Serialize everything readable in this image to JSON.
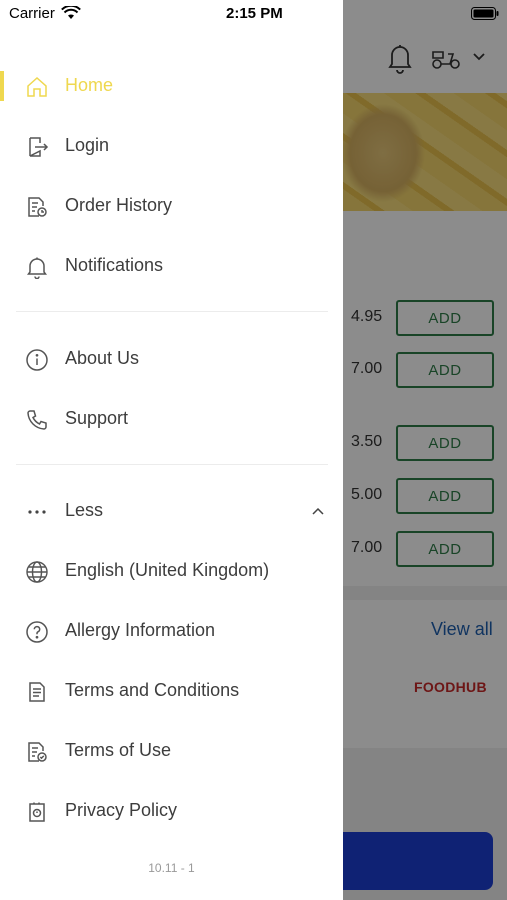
{
  "status_bar": {
    "carrier": "Carrier",
    "time": "2:15 PM"
  },
  "drawer": {
    "items_group1": [
      {
        "label": "Home",
        "icon": "home-icon",
        "active": true
      },
      {
        "label": "Login",
        "icon": "login-icon",
        "active": false
      },
      {
        "label": "Order History",
        "icon": "order-history-icon",
        "active": false
      },
      {
        "label": "Notifications",
        "icon": "bell-icon",
        "active": false
      }
    ],
    "items_group2": [
      {
        "label": "About Us",
        "icon": "info-icon"
      },
      {
        "label": "Support",
        "icon": "phone-icon"
      }
    ],
    "less_label": "Less",
    "items_group3": [
      {
        "label": "English (United Kingdom)",
        "icon": "globe-icon"
      },
      {
        "label": "Allergy Information",
        "icon": "question-icon"
      },
      {
        "label": "Terms and Conditions",
        "icon": "document-icon"
      },
      {
        "label": "Terms of Use",
        "icon": "document-check-icon"
      },
      {
        "label": "Privacy Policy",
        "icon": "privacy-icon"
      }
    ],
    "version": "10.11 - 1",
    "accent_color": "#efd84f"
  },
  "background": {
    "items": [
      {
        "price": "4.95",
        "button": "ADD"
      },
      {
        "price": "7.00",
        "button": "ADD"
      },
      {
        "price": "3.50",
        "button": "ADD"
      },
      {
        "price": "5.00",
        "button": "ADD"
      },
      {
        "price": "7.00",
        "button": "ADD"
      }
    ],
    "view_all": "View all",
    "brand": "FOODHUB"
  }
}
